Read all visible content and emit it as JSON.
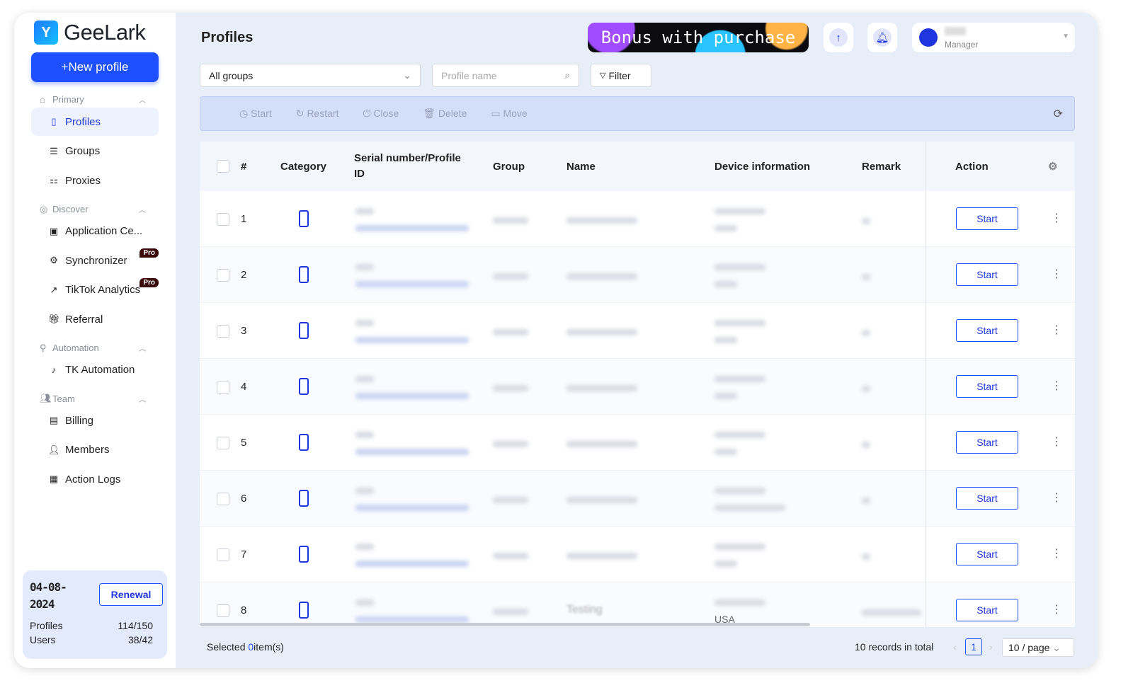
{
  "app": {
    "name": "GeeLark",
    "new_profile": "+New profile"
  },
  "sidebar": {
    "sections": [
      {
        "label": "Primary",
        "items": [
          "Profiles",
          "Groups",
          "Proxies"
        ]
      },
      {
        "label": "Discover",
        "items": [
          "Application Ce...",
          "Synchronizer",
          "TikTok Analytics",
          "Referral"
        ]
      },
      {
        "label": "Automation",
        "items": [
          "TK Automation"
        ]
      },
      {
        "label": "Team",
        "items": [
          "Billing",
          "Members",
          "Action Logs"
        ]
      }
    ],
    "pro_badge": "Pro",
    "plan": {
      "date": "04-08-2024",
      "renew": "Renewal",
      "profiles_label": "Profiles",
      "profiles_value": "114/150",
      "users_label": "Users",
      "users_value": "38/42"
    }
  },
  "header": {
    "title": "Profiles",
    "banner": "Bonus with purchase",
    "user_role": "Manager"
  },
  "filters": {
    "group": "All groups",
    "search_placeholder": "Profile name",
    "filter": "Filter"
  },
  "toolbar": [
    "Start",
    "Restart",
    "Close",
    "Delete",
    "Move"
  ],
  "table": {
    "columns": [
      "#",
      "Category",
      "Serial number/Profile ID",
      "Group",
      "Name",
      "Device information",
      "Remark",
      "Action"
    ],
    "rows": [
      1,
      2,
      3,
      4,
      5,
      6,
      7,
      8
    ],
    "row8_name": "Testing",
    "row8_device": "USA",
    "start": "Start"
  },
  "footer": {
    "selected_prefix": "Selected",
    "selected_count": "0",
    "selected_suffix": "item(s)",
    "total": "10 records in total",
    "page": "1",
    "page_size": "10 / page"
  },
  "colors": {
    "accent": "#1f50ff"
  }
}
